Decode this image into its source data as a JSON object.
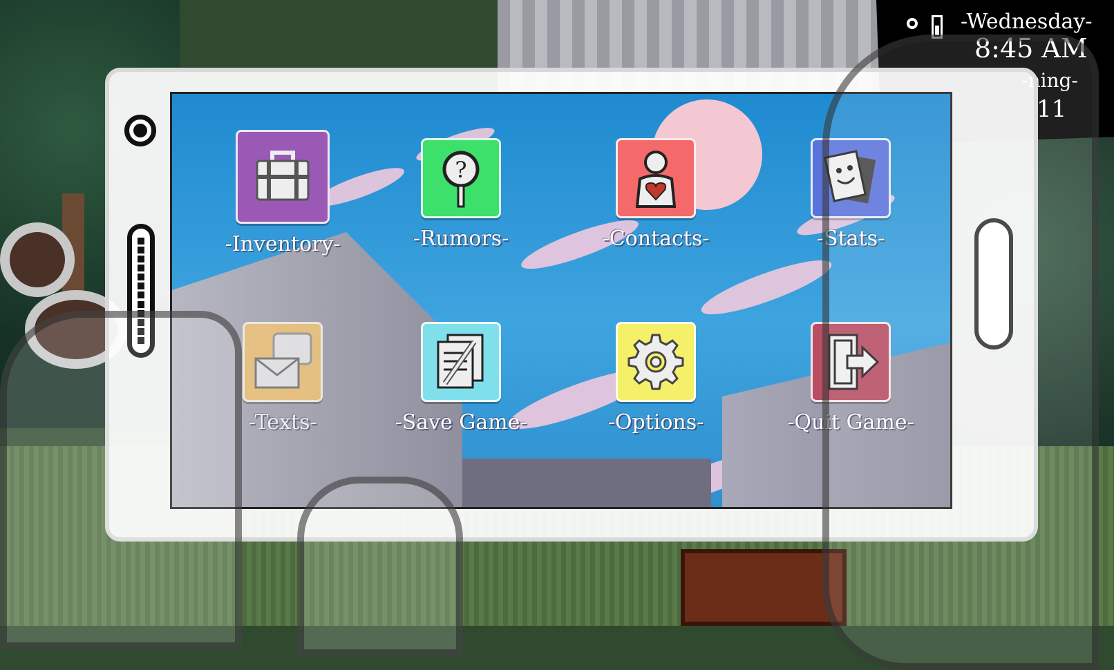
{
  "clock": {
    "day": "-Wednesday-",
    "time": "8:45 AM",
    "period": "-ning-",
    "number": "11"
  },
  "apps": [
    {
      "id": "inventory",
      "label": "-Inventory-",
      "color": "#9b59b6",
      "icon": "briefcase-icon",
      "selected": true
    },
    {
      "id": "rumors",
      "label": "-Rumors-",
      "color": "#3ee06c",
      "icon": "magnifier-question-icon",
      "selected": false
    },
    {
      "id": "contacts",
      "label": "-Contacts-",
      "color": "#f46a6a",
      "icon": "person-heart-icon",
      "selected": false
    },
    {
      "id": "stats",
      "label": "-Stats-",
      "color": "#5a73db",
      "icon": "stat-cards-icon",
      "selected": false
    },
    {
      "id": "texts",
      "label": "-Texts-",
      "color": "#f5c777",
      "icon": "envelope-bubble-icon",
      "selected": false
    },
    {
      "id": "save-game",
      "label": "-Save Game-",
      "color": "#7fe0ec",
      "icon": "notepad-pencil-icon",
      "selected": false
    },
    {
      "id": "options",
      "label": "-Options-",
      "color": "#f4f06a",
      "icon": "gear-icon",
      "selected": false
    },
    {
      "id": "quit-game",
      "label": "-Quit Game-",
      "color": "#b84d63",
      "icon": "exit-door-icon",
      "selected": false
    }
  ]
}
